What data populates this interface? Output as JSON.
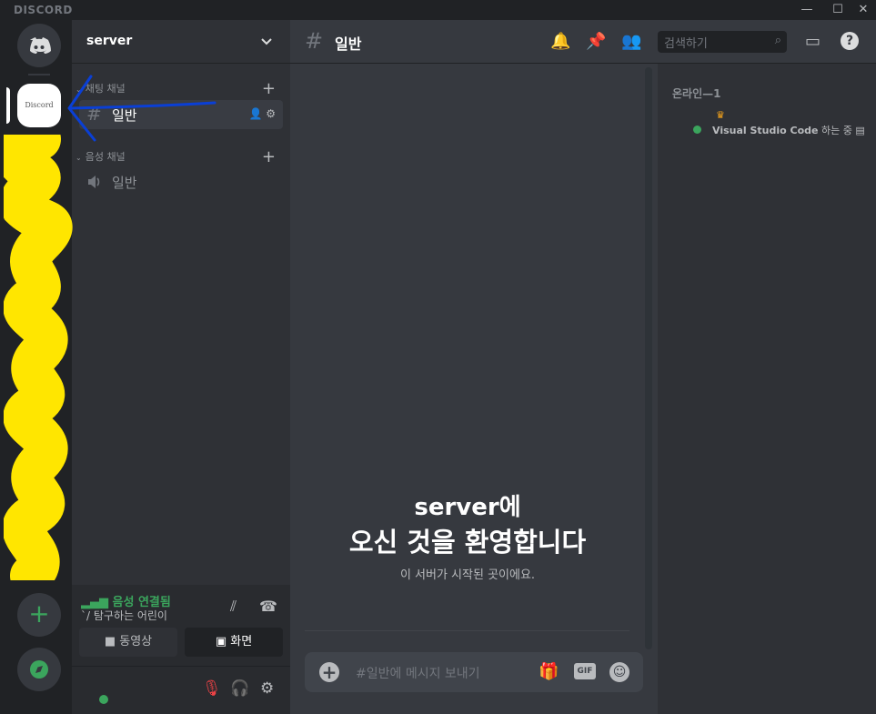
{
  "titlebar": {
    "brand": "DISCORD",
    "min": "—",
    "max": "☐",
    "close": "✕"
  },
  "server": {
    "name": "server",
    "icon_text": "Discord"
  },
  "categories": [
    {
      "label": "채팅 채널"
    },
    {
      "label": "음성 채널"
    }
  ],
  "channels": [
    {
      "label": "일반"
    },
    {
      "label": "일반"
    }
  ],
  "voice": {
    "status": "음성 연결됨",
    "sub": "`/ 탐구하는 어린이",
    "video_label": "동영상",
    "screen_label": "화면"
  },
  "chat": {
    "channel_title": "일반",
    "search_placeholder": "검색하기",
    "welcome_line1": "server에",
    "welcome_line2": "오신 것을 환영합니다",
    "welcome_sub": "이 서버가 시작된 곳이에요.",
    "composer_placeholder": "#일반에 메시지 보내기",
    "gif_label": "GIF"
  },
  "members": {
    "header": "온라인—1",
    "list": [
      {
        "activity_app": "Visual Studio Code",
        "activity_suffix": "하는 중"
      }
    ]
  },
  "colors": {
    "accent_green": "#3ba55d",
    "highlight_yellow": "#ffe600",
    "arrow_blue": "#0a3fd6"
  }
}
